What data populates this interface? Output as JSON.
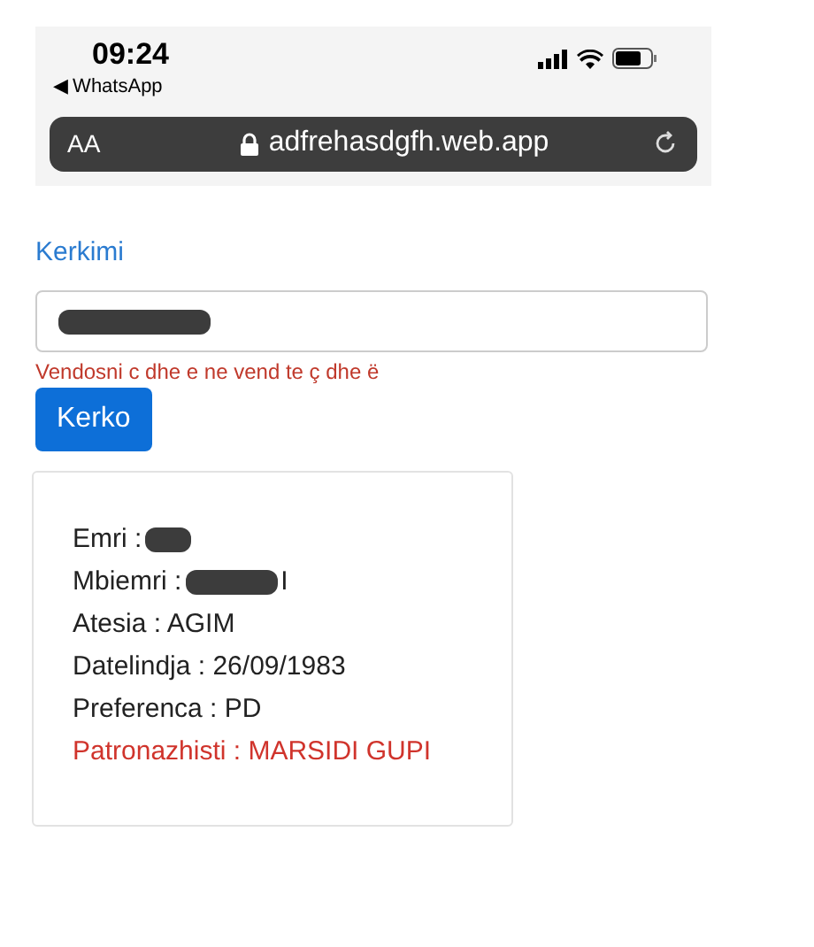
{
  "status_bar": {
    "time": "09:24",
    "back_app": "◀ WhatsApp"
  },
  "address_bar": {
    "text_size": "AA",
    "url": "adfrehasdgfh.web.app"
  },
  "search": {
    "title": "Kerkimi",
    "value_redacted": true,
    "hint": "Vendosni c dhe e ne vend te ç dhe ë",
    "button": "Kerko"
  },
  "result": {
    "lines": [
      {
        "kind": "plain",
        "label": "Emri :",
        "redacted": true
      },
      {
        "kind": "plain",
        "label": "Mbiemri :",
        "value": "I",
        "redacted": true
      },
      {
        "kind": "plain",
        "label": "Atesia : AGIM",
        "redacted": false
      },
      {
        "kind": "plain",
        "label": "Datelindja : 26/09/1983",
        "redacted": false
      },
      {
        "kind": "plain",
        "label": "Preferenca : PD",
        "redacted": false
      },
      {
        "kind": "alert",
        "label": "Patronazhisti : MARSIDI GUPI",
        "redacted": false
      }
    ]
  }
}
